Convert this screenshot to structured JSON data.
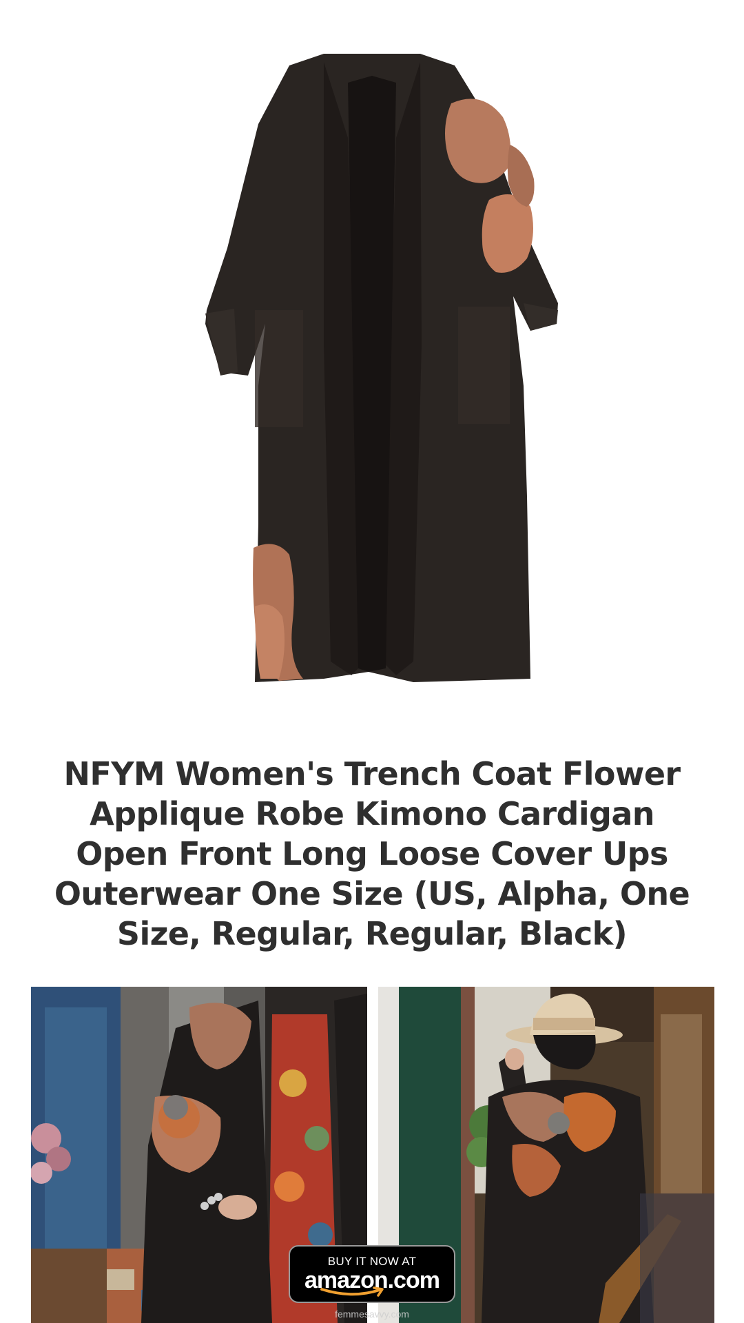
{
  "product": {
    "title": "NFYM Women's Trench Coat Flower Applique Robe Kimono Cardigan Open Front Long Loose Cover Ups Outerwear One Size (US, Alpha, One Size, Regular, Regular, Black)",
    "hero_image": "product-photo",
    "color_name": "Black"
  },
  "gallery": [
    {
      "image": "lifestyle-photo-front"
    },
    {
      "image": "lifestyle-photo-back"
    }
  ],
  "buy_button": {
    "top_label": "BUY IT NOW AT",
    "brand_label": "amazon.com"
  },
  "watermark": "femmesavvy.com",
  "colors": {
    "garment": "#2a2522",
    "applique": "#b77a5e",
    "title_text": "#2f2f2f",
    "button_bg": "#000000",
    "amazon_orange": "#f0a030"
  }
}
